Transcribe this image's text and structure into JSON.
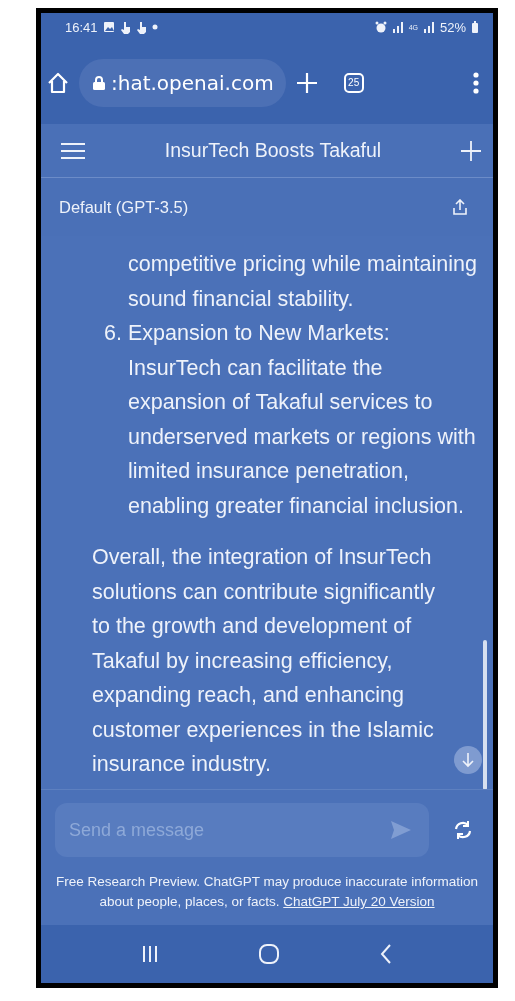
{
  "status_bar": {
    "time": "16:41",
    "network": "4G",
    "battery": "52%"
  },
  "browser": {
    "url": ":hat.openai.com",
    "tab_count": "25"
  },
  "chat_header": {
    "title": "InsurTech Boosts Takaful"
  },
  "model_bar": {
    "model": "Default (GPT-3.5)"
  },
  "message": {
    "list_items": [
      {
        "text": "competitive pricing while maintaining sound financial stability."
      },
      {
        "number": "6.",
        "title": "Expansion to New Markets:",
        "text": "InsurTech can facilitate the expansion of Takaful services to underserved markets or regions with limited insurance penetration, enabling greater financial inclusion."
      }
    ],
    "paragraph": "Overall, the integration of InsurTech solutions can contribute significantly to the growth and development of Takaful by increasing efficiency, expanding reach, and enhancing customer experiences in the Islamic insurance industry."
  },
  "composer": {
    "placeholder": "Send a message"
  },
  "footer": {
    "text": "Free Research Preview. ChatGPT may produce inaccurate information about people, places, or facts.",
    "link": "ChatGPT July 20 Version"
  }
}
